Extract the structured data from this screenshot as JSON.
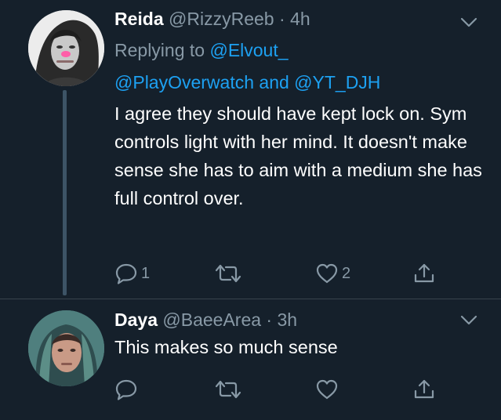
{
  "tweets": [
    {
      "name": "Reida",
      "handle": "@RizzyReeb",
      "dot": "·",
      "time": "4h",
      "replying_prefix": "Replying to",
      "replying_user1": "@Elvout_",
      "replying_user2": "@PlayOverwatch",
      "replying_and": "and",
      "replying_user3": "@YT_DJH",
      "text": "I agree they should have kept lock on. Sym controls light with her mind. It doesn't make sense she has to aim with a medium she has full control over.",
      "reply_count": "1",
      "retweet_count": "",
      "like_count": "2",
      "avatar_icon": "user-avatar"
    },
    {
      "name": "Daya",
      "handle": "@BaeeArea",
      "dot": "·",
      "time": "3h",
      "text": "This makes so much sense",
      "reply_count": "",
      "retweet_count": "",
      "like_count": "",
      "avatar_icon": "user-avatar"
    }
  ],
  "icons": {
    "reply": "reply-icon",
    "retweet": "retweet-icon",
    "like": "heart-icon",
    "share": "share-icon",
    "menu": "chevron-down-icon"
  },
  "colors": {
    "background": "#15202b",
    "text": "#ffffff",
    "muted": "#8899a6",
    "link": "#1da1f2",
    "divider": "#38444d"
  }
}
